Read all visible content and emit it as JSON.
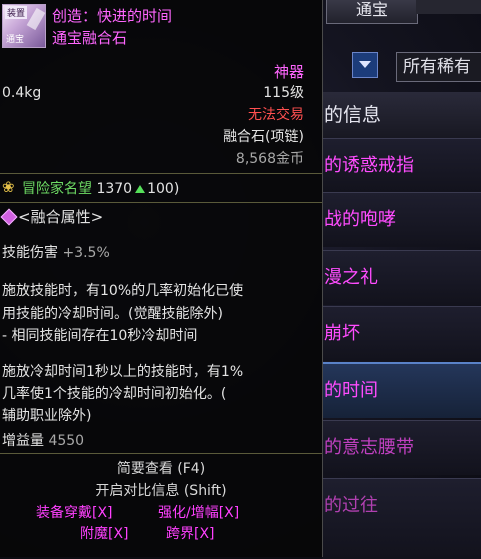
{
  "background": {
    "tab": "通宝",
    "dropdown": "所有稀有",
    "header": "的信息",
    "rows": [
      {
        "text": "的诱惑戒指",
        "color": "#ff4cff"
      },
      {
        "text": "战的咆哮",
        "color": "#ff4cff"
      },
      {
        "text": "漫之礼",
        "color": "#ff4cff"
      },
      {
        "text": "崩坏",
        "color": "#ff4cff"
      },
      {
        "text": "的时间",
        "color": "#ff4cff"
      },
      {
        "text": "的意志腰带",
        "color": "#c040c0"
      },
      {
        "text": "的过往",
        "color": "#b040b0"
      }
    ]
  },
  "tooltip": {
    "icon": {
      "top_label": "装置",
      "bottom_label": "通宝",
      "name": "item-icon"
    },
    "name": "创造：快进的时间",
    "subtitle": "通宝融合石",
    "weight": "0.4kg",
    "rarity": "神器",
    "level": "115级",
    "trade": "无法交易",
    "type": "融合石(项链)",
    "price": "8,568金币",
    "reputation": {
      "label": "冒险家名望",
      "value": "1370",
      "increase": "100"
    },
    "fusion_header": "<融合属性>",
    "skill_damage": {
      "label": "技能伤害",
      "value": "+3.5%"
    },
    "effect1": [
      "施放技能时，有10%的几率初始化已使",
      "用技能的冷却时间。(觉醒技能除外)",
      "- 相同技能间存在10秒冷却时间"
    ],
    "effect2": [
      "施放冷却时间1秒以上的技能时，有1%",
      "几率使1个技能的冷却时间初始化。(",
      "辅助职业除外)"
    ],
    "buff": {
      "label": "增益量",
      "value": "4550"
    },
    "shortcuts": [
      "简要查看 (F4)",
      "开启对比信息 (Shift)"
    ],
    "actions": {
      "equip": "装备穿戴[X]",
      "enhance": "强化/增幅[X]",
      "enchant": "附魔[X]",
      "cross": "跨界[X]"
    }
  }
}
